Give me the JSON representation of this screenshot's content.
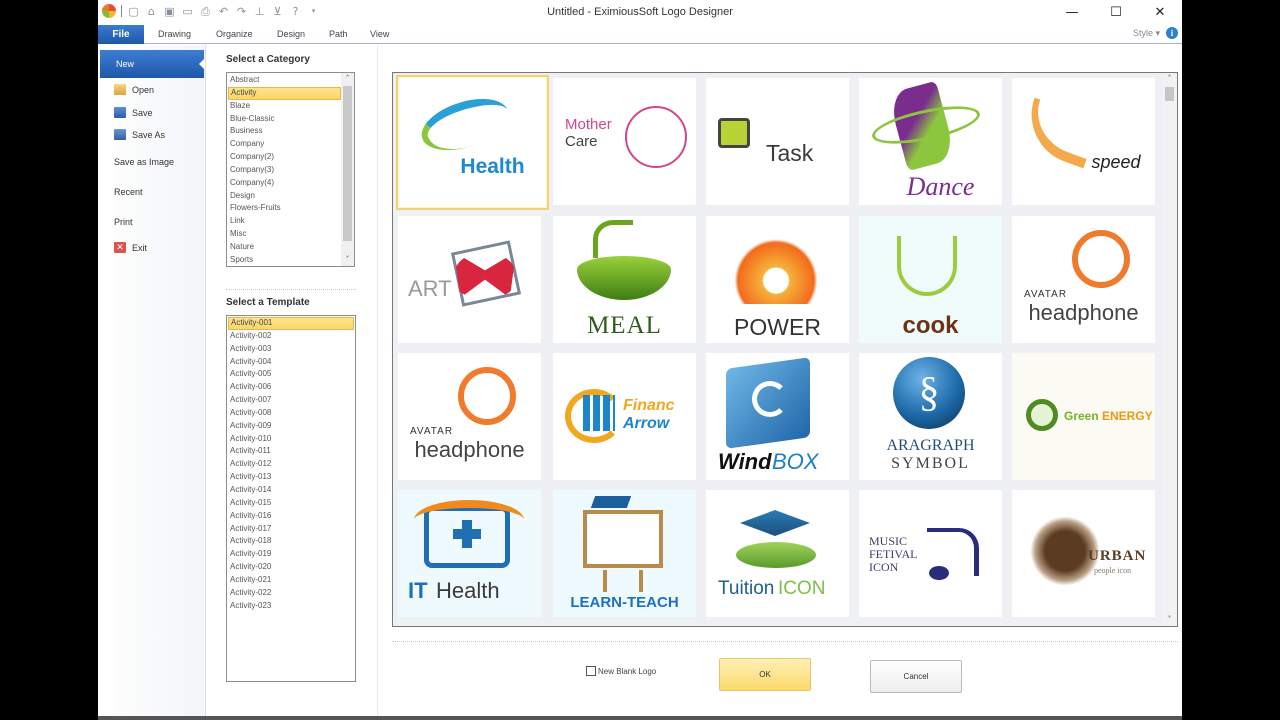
{
  "window": {
    "title": "Untitled - EximiousSoft Logo Designer",
    "controls": {
      "minimize": "—",
      "maximize": "☐",
      "close": "✕"
    }
  },
  "quick_access": [
    "app-logo",
    "new-icon",
    "open-icon",
    "save-icon",
    "image-icon",
    "print-icon",
    "undo-icon",
    "redo-icon",
    "stamp-icon",
    "cart-icon",
    "help-icon",
    "dropdown-icon"
  ],
  "ribbon": {
    "tabs": [
      "File",
      "Drawing",
      "Organize",
      "Design",
      "Path",
      "View"
    ],
    "active_tab": "File",
    "style_label": "Style ▾",
    "info_icon": "i"
  },
  "file_menu": {
    "selected": "New",
    "items": [
      {
        "label": "New"
      },
      {
        "label": "Open",
        "icon": "open-folder-icon"
      },
      {
        "label": "Save",
        "icon": "floppy-disk-icon"
      },
      {
        "label": "Save As",
        "icon": "save-as-icon"
      },
      {
        "label": "Save as Image"
      },
      {
        "label": "Recent"
      },
      {
        "label": "Print"
      },
      {
        "label": "Exit",
        "icon": "exit-icon"
      }
    ]
  },
  "category": {
    "title": "Select a Category",
    "selected": "Activity",
    "items": [
      "Abstract",
      "Activity",
      "Blaze",
      "Blue-Classic",
      "Business",
      "Company",
      "Company(2)",
      "Company(3)",
      "Company(4)",
      "Design",
      "Flowers-Fruits",
      "Link",
      "Misc",
      "Nature",
      "Sports"
    ]
  },
  "template": {
    "title": "Select a Template",
    "selected": "Activity-001",
    "items": [
      "Activity-001",
      "Activity-002",
      "Activity-003",
      "Activity-004",
      "Activity-005",
      "Activity-006",
      "Activity-007",
      "Activity-008",
      "Activity-009",
      "Activity-010",
      "Activity-011",
      "Activity-012",
      "Activity-013",
      "Activity-014",
      "Activity-015",
      "Activity-016",
      "Activity-017",
      "Activity-018",
      "Activity-019",
      "Activity-020",
      "Activity-021",
      "Activity-022",
      "Activity-023"
    ]
  },
  "logos": [
    {
      "text": "Health",
      "color": "#1e88d0"
    },
    {
      "text": "Mother Care",
      "line1": "Mother",
      "line2": "Care",
      "color": "#d0468f",
      "color2": "#444"
    },
    {
      "text": "Task",
      "color": "#3b3b3b",
      "accent": "#b7d334"
    },
    {
      "text": "Dance",
      "color": "#7b2d8e",
      "accent": "#8cc63f"
    },
    {
      "text": "speed",
      "color": "#222",
      "accent": "#f39c2b"
    },
    {
      "text": "ART",
      "color": "#999",
      "accent": "#d7263d"
    },
    {
      "text": "MEAL",
      "color": "#2f5e1c",
      "accent": "#6aa520"
    },
    {
      "text": "POWER",
      "color": "#333",
      "accent": "#f26b1d"
    },
    {
      "text": "cook",
      "color": "#6b3416",
      "accent": "#9ccc3c"
    },
    {
      "text": "headphone",
      "small": "AVATAR",
      "color": "#444",
      "accent": "#ef7b2c"
    },
    {
      "text": "headphone",
      "small": "AVATAR",
      "color": "#444",
      "accent": "#ef7b2c"
    },
    {
      "text": "Financ Arrow",
      "line1": "Financ",
      "line2": "Arrow",
      "color": "#f0a81e",
      "color2": "#1d86c9"
    },
    {
      "text": "WindBOX",
      "line1": "Wind",
      "line2": "BOX",
      "color": "#111",
      "color2": "#1f7fc4"
    },
    {
      "text": "ARAGRAPH SYMBOL",
      "line1": "ARAGRAPH",
      "line2": "SYMBOL",
      "color": "#1f4e79",
      "accent": "#1c6aa8"
    },
    {
      "text": "GreenENERGY",
      "line1": "Green",
      "line2": "ENERGY",
      "color": "#7ab02c",
      "color2": "#e89a12"
    },
    {
      "text": "ITHealth",
      "line1": "IT",
      "line2": "Health",
      "color": "#1f6fb2",
      "color2": "#3a3a3a",
      "accent": "#f08a1c"
    },
    {
      "text": "LEARN-TEACH",
      "color": "#1d6fc2",
      "accent": "#b98a4b"
    },
    {
      "text": "TuitionICON",
      "line1": "Tuition",
      "line2": "ICON",
      "color": "#1e5f8c",
      "color2": "#7cc04a"
    },
    {
      "text": "MUSIC FETIVAL ICON",
      "lines": [
        "MUSIC",
        "FETIVAL",
        "ICON"
      ],
      "color": "#3c3c6a",
      "accent": "#2a2d7c"
    },
    {
      "text": "URBAN people icon",
      "line1": "URBAN",
      "line2": "people icon",
      "color": "#5b3b22"
    }
  ],
  "footer": {
    "new_blank_logo_label": "New Blank Logo",
    "new_blank_logo_checked": false,
    "ok_label": "OK",
    "cancel_label": "Cancel"
  }
}
